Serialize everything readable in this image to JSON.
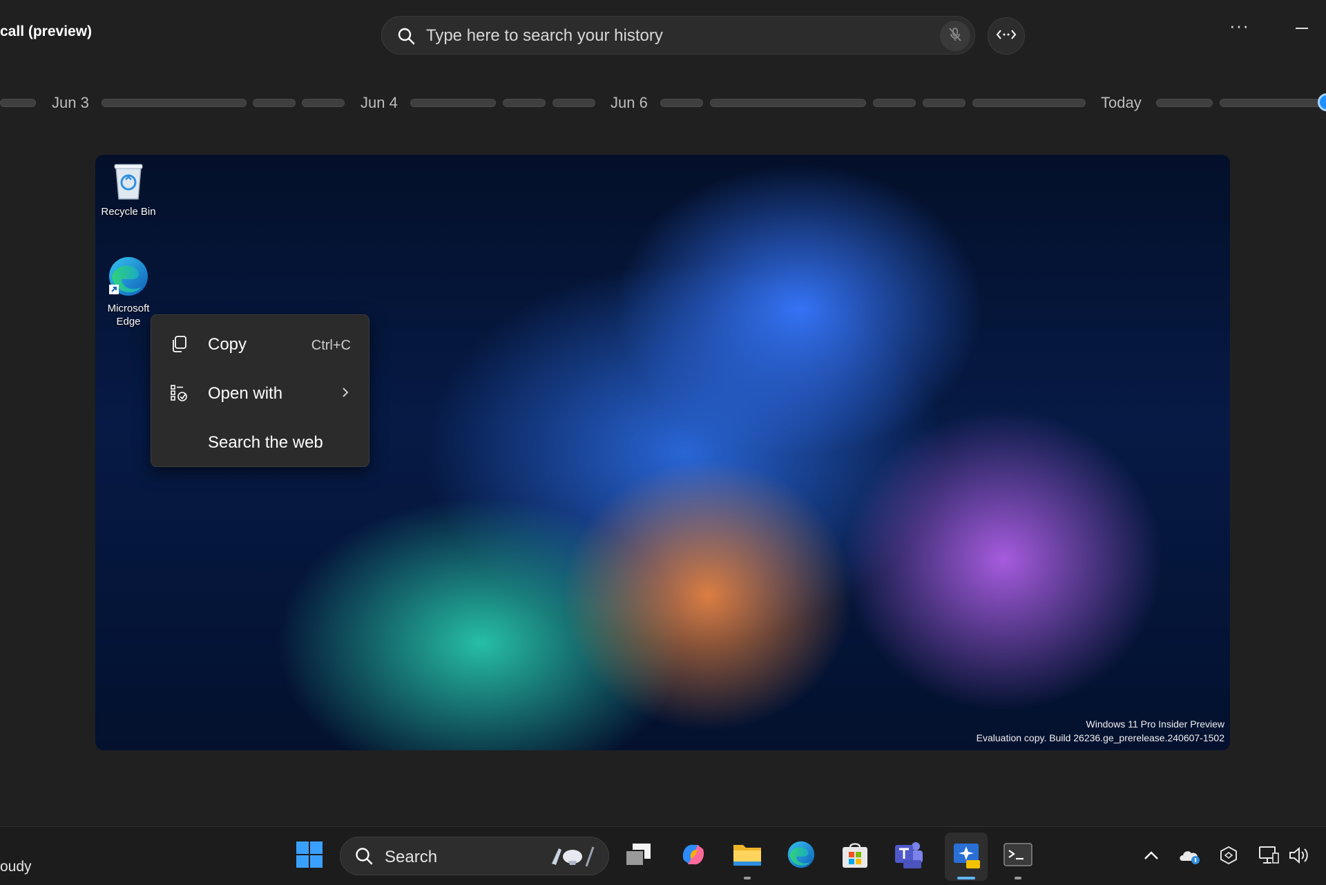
{
  "app": {
    "title": "call (preview)"
  },
  "search": {
    "placeholder": "Type here to search your history",
    "mic_icon": "mic-off-icon",
    "code_icon": "code-brackets-icon"
  },
  "window_controls": {
    "more_label": "···"
  },
  "timeline": {
    "labels": [
      "Jun 3",
      "Jun 4",
      "Jun 6",
      "Today"
    ]
  },
  "desktop": {
    "icons": [
      {
        "label": "Recycle Bin",
        "icon": "recycle-bin-icon"
      },
      {
        "label_line1": "Microsoft",
        "label_line2": "Edge",
        "icon": "edge-icon"
      }
    ],
    "watermark": {
      "line1": "Windows 11 Pro Insider Preview",
      "line2": "Evaluation copy. Build 26236.ge_prerelease.240607-1502"
    }
  },
  "context_menu": {
    "items": [
      {
        "label": "Copy",
        "shortcut": "Ctrl+C",
        "icon": "copy-icon"
      },
      {
        "label": "Open with",
        "icon": "open-with-icon",
        "submenu_icon": "chevron-right-icon"
      },
      {
        "label": "Search the web"
      }
    ]
  },
  "taskbar": {
    "weather_text": "oudy",
    "search_label": "Search",
    "apps": [
      "start-icon",
      "task-view-icon",
      "copilot-icon",
      "file-explorer-icon",
      "edge-icon",
      "microsoft-store-icon",
      "teams-icon",
      "recall-icon",
      "terminal-icon"
    ],
    "tray": [
      "chevron-up-icon",
      "onedrive-icon",
      "copilot-tray-icon",
      "network-icon",
      "volume-icon"
    ]
  },
  "colors": {
    "background": "#202020",
    "accent": "#1e90ff",
    "menu_background": "#2b2b2b",
    "taskbar": "#1c1c1c"
  }
}
